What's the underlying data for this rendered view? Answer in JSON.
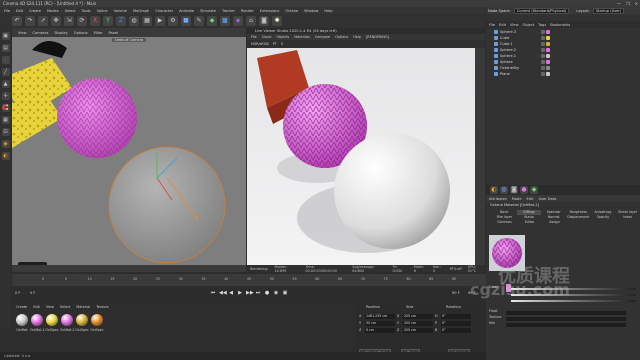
{
  "window": {
    "title": "Cinema 4D S24.111 (RC) - [Untitled 4 *] - Main",
    "controls": [
      "—",
      "❐",
      "✕"
    ]
  },
  "menu": [
    "File",
    "Edit",
    "Create",
    "Modes",
    "Select",
    "Tools",
    "Spline",
    "Volume",
    "MoGraph",
    "Character",
    "Animate",
    "Simulate",
    "Tracker",
    "Render",
    "Extensions",
    "Octane",
    "Window",
    "Help"
  ],
  "layout": {
    "node_space_label": "Node Space:",
    "node_space_value": "Current (Standard/Physical)",
    "layout_label": "Layout:",
    "layout_value": "Startup (User)"
  },
  "viewport": {
    "menu": [
      "View",
      "Cameras",
      "Display",
      "Options",
      "Filter",
      "Panel"
    ],
    "camera": "Default Camera",
    "tooltip": "Delete"
  },
  "render_view": {
    "title": "Live Viewer Studio 2020.1.4-R4 (26 days left)",
    "menu": [
      "File",
      "Cloud",
      "Objects",
      "Materials",
      "Compare",
      "Options",
      "Help",
      "[RENDERING]"
    ],
    "toolbar": [
      "HDR/sRGB",
      "PT",
      "0"
    ],
    "status": [
      "Rendering:",
      "Ms/sec: 14.699",
      "Time: 00:00:00/00:00:00",
      "Spp/maxspp: 64/800",
      "Tri: 0/33k",
      "Mesh: 6",
      "Hair: 0",
      "RTX:off",
      "GPU: 51°C"
    ]
  },
  "objects_panel": {
    "tabs": [
      "File",
      "Edit",
      "View",
      "Object",
      "Tags",
      "Bookmarks"
    ],
    "items": [
      "Sphere.3",
      "Cube",
      "Cube.1",
      "Sphere.2",
      "Sphere.1",
      "Sphere",
      "OctaneSky",
      "Plane"
    ]
  },
  "attributes": {
    "panel_label": "Attributes",
    "menu": [
      "Mode",
      "Edit",
      "User Data"
    ],
    "material_name": "Octane Material [OctMat.2]",
    "channel_rows": [
      [
        "Basic",
        "Diffuse",
        "Specular",
        "Roughness",
        "Anisotropy",
        "Sheen layer"
      ],
      [
        "Film layer",
        "Bump",
        "Normal",
        "Displacement",
        "Opacity",
        "Index"
      ],
      [
        "Common",
        "Editor",
        "Assign"
      ]
    ],
    "active_channel": "Diffuse",
    "fields": [
      "Color",
      "Float",
      "Texture",
      "Mix"
    ]
  },
  "timeline": {
    "ticks": [
      "0",
      "5",
      "10",
      "15",
      "20",
      "25",
      "30",
      "35",
      "40",
      "45",
      "50",
      "55",
      "60",
      "65",
      "70",
      "75",
      "80",
      "85",
      "90"
    ],
    "start": "0 F",
    "end": "90 F",
    "current": "0 F",
    "current_right": "90 F",
    "controls": [
      "⏮",
      "◀◀",
      "◀",
      "▶",
      "▶▶",
      "⏭",
      "●",
      "◉",
      "▣"
    ]
  },
  "material_manager": {
    "menu": [
      "Create",
      "Edit",
      "View",
      "Select",
      "Material",
      "Texture"
    ],
    "materials": [
      {
        "label": "OctMat",
        "color": "#c8c8c8"
      },
      {
        "label": "OctMat.1",
        "color": "#e070e0"
      },
      {
        "label": "OctSpec",
        "color": "#e6d63a"
      },
      {
        "label": "OctMat.2",
        "color": "#e070e0"
      },
      {
        "label": "OctSpec",
        "color": "#d7b030"
      },
      {
        "label": "OctSpec",
        "color": "#e08a20"
      }
    ]
  },
  "coordinates": {
    "headers": [
      "Position",
      "Size",
      "Rotation"
    ],
    "rows": [
      [
        "X",
        "1461.235 cm",
        "X",
        "200 cm",
        "H",
        "0°"
      ],
      [
        "Y",
        "50 cm",
        "Y",
        "200 cm",
        "P",
        "0°"
      ],
      [
        "Z",
        "0 cm",
        "Z",
        "200 cm",
        "B",
        "0°"
      ]
    ],
    "mode": "Object (Rel)",
    "size_mode": "Size",
    "apply": "Apply"
  },
  "status_bar": "Updated: 0 ms",
  "watermark": {
    "line1": "优质课程",
    "line2": "cgzisu.com"
  },
  "colors": {
    "pink": "#e070e0",
    "yellow": "#e6d63a",
    "red": "#b03a22"
  }
}
